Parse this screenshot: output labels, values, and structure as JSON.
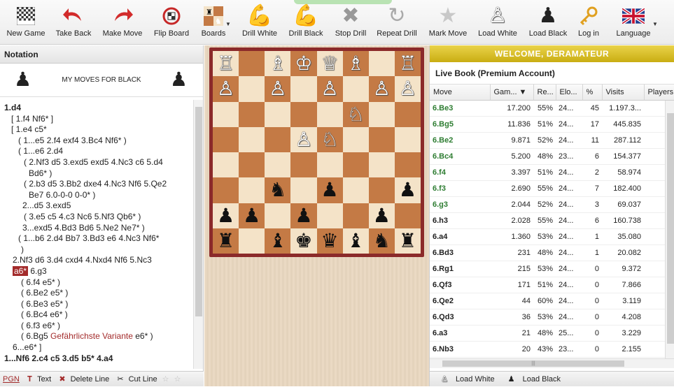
{
  "toolbar": {
    "new_game": "New Game",
    "take_back": "Take Back",
    "make_move": "Make Move",
    "flip_board": "Flip Board",
    "boards": "Boards",
    "drill_white": "Drill White",
    "drill_black": "Drill Black",
    "stop_drill": "Stop Drill",
    "repeat_drill": "Repeat Drill",
    "mark_move": "Mark Move",
    "load_white": "Load White",
    "load_black": "Load Black",
    "log_in": "Log in",
    "language": "Language"
  },
  "notation": {
    "header": "Notation",
    "moves_for": "MY MOVES FOR BLACK",
    "footer": {
      "pgn": "PGN",
      "text": "Text",
      "delete_line": "Delete Line",
      "cut_line": "Cut Line"
    }
  },
  "board": {
    "rows": [
      [
        "",
        "",
        "♖",
        "",
        "♔",
        "♕",
        "♗",
        "",
        "♖"
      ],
      [
        "♙",
        "♙",
        "",
        "♙",
        "",
        "♙",
        "",
        "♙"
      ],
      [
        "",
        "",
        "",
        "",
        "",
        "♘",
        "",
        ""
      ],
      [
        "",
        "",
        "",
        "♙",
        "♘",
        "",
        "",
        ""
      ],
      [
        "",
        "",
        "",
        "",
        "",
        "",
        "",
        ""
      ],
      [
        "",
        "",
        "♞",
        "",
        "♟",
        "",
        "",
        "♟"
      ],
      [
        "♟",
        "♟",
        "",
        "♟",
        "",
        "",
        "♟",
        ""
      ],
      [
        "♜",
        "",
        "♝",
        "♚",
        "♛",
        "♝",
        "♞",
        "♜"
      ]
    ],
    "rows_fixed": [
      [
        "♖",
        "",
        "♗",
        "♔",
        "♕",
        "♗",
        "",
        "♖"
      ],
      [
        "♙",
        "",
        "♙",
        "",
        "♙",
        "",
        "♙",
        "♙"
      ],
      [
        "",
        "",
        "",
        "",
        "",
        "♘",
        "",
        ""
      ],
      [
        "",
        "",
        "",
        "♙",
        "♘",
        "",
        "",
        ""
      ],
      [
        "",
        "",
        "",
        "",
        "",
        "",
        "",
        ""
      ],
      [
        "",
        "",
        "♞",
        "",
        "♟",
        "",
        "",
        "♟"
      ],
      [
        "♟",
        "♟",
        "",
        "♟",
        "",
        "",
        "♟",
        ""
      ],
      [
        "♜",
        "",
        "♝",
        "♚",
        "♛",
        "♝",
        "♞",
        "♜"
      ]
    ]
  },
  "right": {
    "welcome": "WELCOME, DERAMATEUR",
    "book_title": "Live Book (Premium Account)",
    "columns": [
      "Move",
      "Gam...",
      "Re...",
      "Elo...",
      "%",
      "Visits",
      "Players"
    ],
    "rows": [
      [
        "6.Be3",
        "17.200",
        "55%",
        "24...",
        "45",
        "1.197.3...",
        "grn"
      ],
      [
        "6.Bg5",
        "11.836",
        "51%",
        "24...",
        "17",
        "445.835",
        "grn"
      ],
      [
        "6.Be2",
        "9.871",
        "52%",
        "24...",
        "11",
        "287.112",
        "grn"
      ],
      [
        "6.Bc4",
        "5.200",
        "48%",
        "23...",
        "6",
        "154.377",
        "grn"
      ],
      [
        "6.f4",
        "3.397",
        "51%",
        "24...",
        "2",
        "58.974",
        "grn"
      ],
      [
        "6.f3",
        "2.690",
        "55%",
        "24...",
        "7",
        "182.400",
        "grn"
      ],
      [
        "6.g3",
        "2.044",
        "52%",
        "24...",
        "3",
        "69.037",
        "grn"
      ],
      [
        "6.h3",
        "2.028",
        "55%",
        "24...",
        "6",
        "160.738",
        ""
      ],
      [
        "6.a4",
        "1.360",
        "53%",
        "24...",
        "1",
        "35.080",
        ""
      ],
      [
        "6.Bd3",
        "231",
        "48%",
        "24...",
        "1",
        "20.082",
        ""
      ],
      [
        "6.Rg1",
        "215",
        "53%",
        "24...",
        "0",
        "9.372",
        ""
      ],
      [
        "6.Qf3",
        "171",
        "51%",
        "24...",
        "0",
        "7.866",
        ""
      ],
      [
        "6.Qe2",
        "44",
        "60%",
        "24...",
        "0",
        "3.119",
        ""
      ],
      [
        "6.Qd3",
        "36",
        "53%",
        "24...",
        "0",
        "4.208",
        ""
      ],
      [
        "6.a3",
        "21",
        "48%",
        "25...",
        "0",
        "3.229",
        ""
      ],
      [
        "6.Nb3",
        "20",
        "43%",
        "23...",
        "0",
        "2.155",
        ""
      ]
    ],
    "footer": {
      "load_white": "Load White",
      "load_black": "Load Black"
    }
  },
  "notation_lines": [
    "1.d4",
    "[ 1.f4  Nf6* ]",
    "[ 1.e4  c5*",
    "( 1...e5  2.f4  exf4  3.Bc4  Nf6* )",
    "( 1...e6  2.d4",
    "( 2.Nf3  d5  3.exd5  exd5  4.Nc3  c6  5.d4",
    "Bd6* )",
    "( 2.b3  d5  3.Bb2  dxe4  4.Nc3  Nf6  5.Qe2",
    "Be7  6.0-0-0  0-0* )",
    "2...d5  3.exd5",
    "( 3.e5  c5  4.c3  Nc6  5.Nf3  Qb6* )",
    "3...exd5  4.Bd3  Bd6  5.Ne2  Ne7* )",
    "( 1...b6  2.d4  Bb7  3.Bd3  e6  4.Nc3  Nf6*",
    ")",
    "2.Nf3  d6  3.d4  cxd4  4.Nxd4  Nf6  5.Nc3",
    "a6*",
    "6.g3",
    "( 6.f4  e5* )",
    "( 6.Be2  e5* )",
    "( 6.Be3  e5* )",
    "( 6.Bc4  e6* )",
    "( 6.f3  e6* )",
    "( 6.Bg5",
    "Gefährlichste Variante",
    "e6* )",
    "6...e6* ]",
    "1...Nf6  2.c4  c5  3.d5  b5*  4.a4"
  ]
}
